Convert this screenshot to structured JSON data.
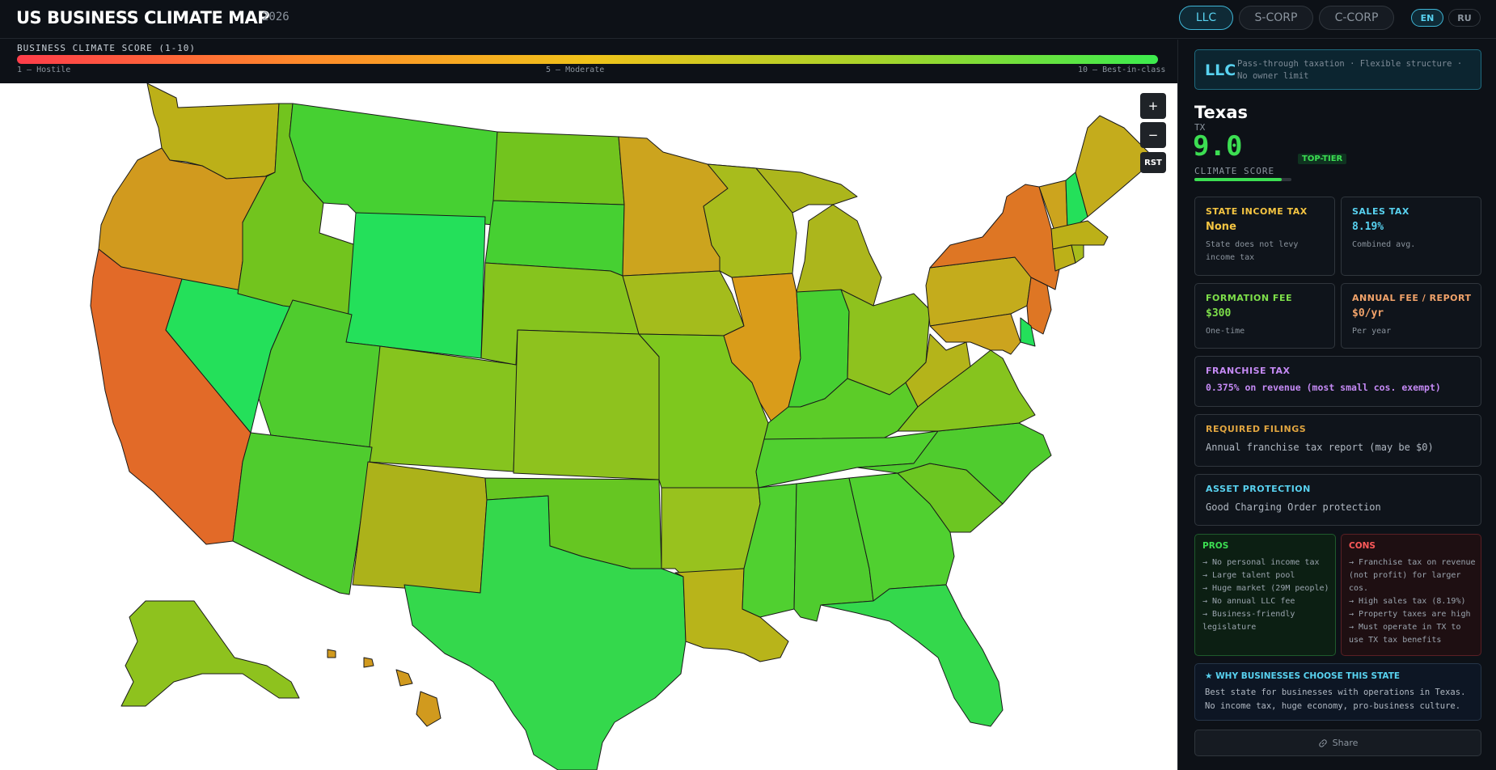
{
  "header": {
    "title": "US BUSINESS CLIMATE MAP",
    "year": "2026",
    "entity_tabs": [
      {
        "label": "LLC",
        "active": true
      },
      {
        "label": "S-CORP",
        "active": false
      },
      {
        "label": "C-CORP",
        "active": false
      }
    ],
    "lang_tabs": [
      {
        "label": "EN",
        "active": true
      },
      {
        "label": "RU",
        "active": false
      }
    ]
  },
  "scorebar": {
    "title": "BUSINESS CLIMATE SCORE (1-10)",
    "min_label": "1 — Hostile",
    "mid_label": "5 — Moderate",
    "max_label": "10 — Best-in-class",
    "colors": [
      "#ff3d4a",
      "#ff8a2a",
      "#f0c21a",
      "#a8d42a",
      "#3cec4e"
    ]
  },
  "map": {
    "zoom_in": "+",
    "zoom_out": "−",
    "reset": "RST"
  },
  "sidebar": {
    "entity": {
      "code": "LLC",
      "desc": "Pass-through taxation · Flexible structure · No owner limit"
    },
    "state": {
      "name": "Texas",
      "code": "TX",
      "score": "9.0",
      "score_fraction": 0.9,
      "tier": "TOP-TIER",
      "score_label": "CLIMATE SCORE"
    },
    "income_tax": {
      "label": "STATE INCOME TAX",
      "value": "None",
      "sub": "State does not levy income tax"
    },
    "sales_tax": {
      "label": "SALES TAX",
      "value": "8.19%",
      "sub": "Combined avg."
    },
    "formation_fee": {
      "label": "FORMATION FEE",
      "value": "$300",
      "sub": "One-time"
    },
    "annual_fee": {
      "label": "ANNUAL FEE / REPORT",
      "value": "$0/yr",
      "sub": "Per year"
    },
    "franchise_tax": {
      "label": "FRANCHISE TAX",
      "value": "0.375% on revenue (most small cos. exempt)"
    },
    "filings": {
      "label": "REQUIRED FILINGS",
      "value": "Annual franchise tax report (may be $0)"
    },
    "asset": {
      "label": "ASSET PROTECTION",
      "value": "Good Charging Order protection"
    },
    "pros": {
      "title": "PROS",
      "items": [
        "→ No personal income tax",
        "→ Large talent pool",
        "→ Huge market (29M people)",
        "→ No annual LLC fee",
        "→ Business-friendly legislature"
      ]
    },
    "cons": {
      "title": "CONS",
      "items": [
        "→ Franchise tax on revenue (not profit) for larger cos.",
        "→ High sales tax (8.19%)",
        "→ Property taxes are high",
        "→ Must operate in TX to use TX tax benefits"
      ]
    },
    "why": {
      "title": "★ WHY BUSINESSES CHOOSE THIS STATE",
      "text": "Best state for businesses with operations in Texas. No income tax, huge economy, pro-business culture."
    },
    "share_label": "Share",
    "colors": {
      "accent": "#58d2f0",
      "income": "#f5c542",
      "sales": "#58d2f0",
      "formation": "#7ee04a",
      "annual": "#f2a36a",
      "franchise": "#c58af5",
      "filings": "#e0a540",
      "asset": "#58d2f0",
      "pros": "#3cde52",
      "cons": "#ff5a5a"
    }
  }
}
